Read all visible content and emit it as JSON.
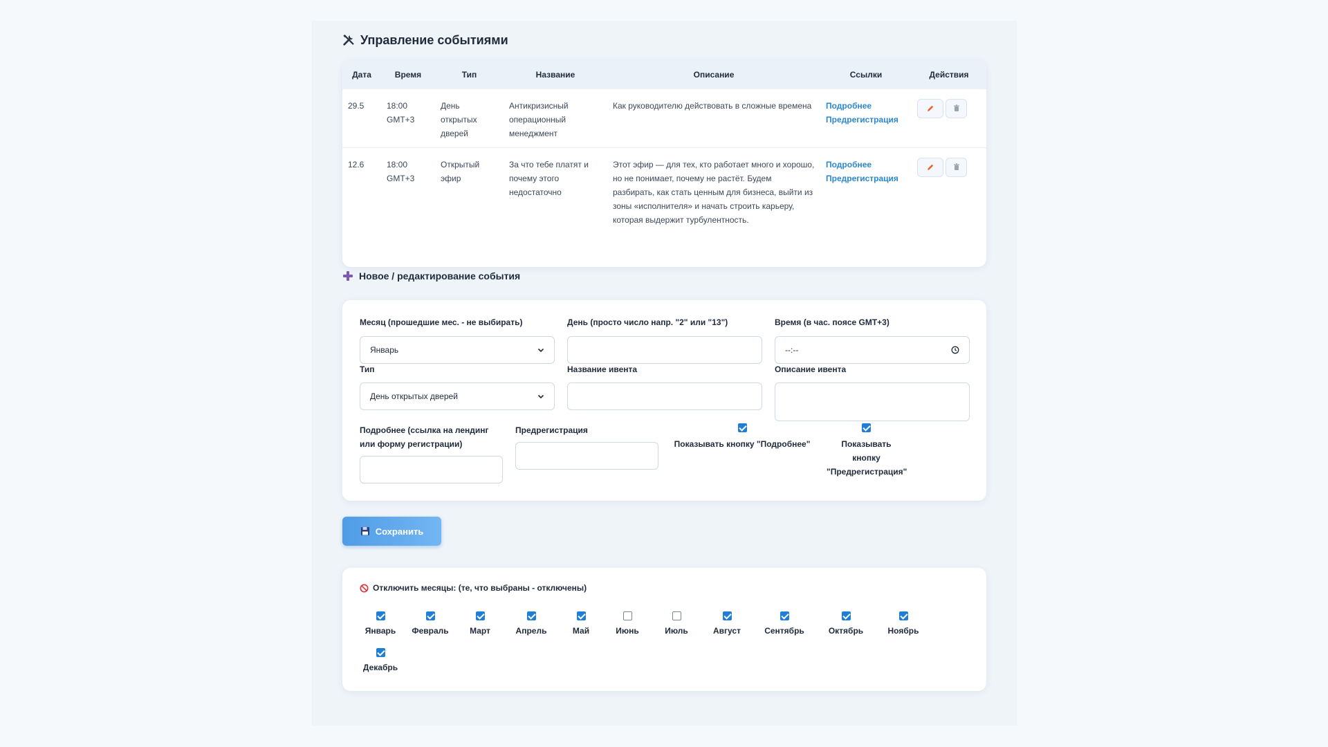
{
  "events": {
    "title": "Управление событиями",
    "columns": [
      "Дата",
      "Время",
      "Тип",
      "Название",
      "Описание",
      "Ссылки",
      "Действия"
    ],
    "rows": [
      {
        "date": "29.5",
        "time": "18:00 GMT+3",
        "type": "День открытых дверей",
        "name": "Антикризисный операционный менеджмент",
        "description": "Как руководителю действовать в сложные времена",
        "link_more": "Подробнее",
        "link_prereg": "Предрегистрация"
      },
      {
        "date": "12.6",
        "time": "18:00 GMT+3",
        "type": "Открытый эфир",
        "name": "За что тебе платят и почему этого недостаточно",
        "description": "Этот эфир — для тех, кто работает много и хорошо, но не понимает, почему не растёт. Будем разбирать, как стать ценным для бизнеса, выйти из зоны «исполнителя» и начать строить карьеру, которая выдержит турбулентность.",
        "link_more": "Подробнее",
        "link_prereg": "Предрегистрация"
      }
    ]
  },
  "form": {
    "title": "Новое / редактирование события",
    "month_label": "Месяц (прошедшие мес. - не выбирать)",
    "month_value": "Январь",
    "day_label": "День (просто число напр. \"2\" или \"13\")",
    "day_value": "",
    "time_label": "Время (в час. поясе GMT+3)",
    "time_value": "--:--",
    "type_label": "Тип",
    "type_value": "День открытых дверей",
    "name_label": "Название ивента",
    "name_value": "",
    "desc_label": "Описание ивента",
    "more_label": "Подробнее (ссылка на лендинг или форму регистрации)",
    "prereg_label": "Предрегистрация",
    "show_more_label": "Показывать кнопку \"Подробнее\"",
    "show_more_checked": true,
    "show_prereg_label": "Показывать кнопку \"Предрегистрация\"",
    "show_prereg_checked": true
  },
  "save_label": "Сохранить",
  "disable_months": {
    "title": "Отключить месяцы: (те, что выбраны - отключены)",
    "months": [
      {
        "name": "Январь",
        "checked": true
      },
      {
        "name": "Февраль",
        "checked": true
      },
      {
        "name": "Март",
        "checked": true
      },
      {
        "name": "Апрель",
        "checked": true
      },
      {
        "name": "Май",
        "checked": true
      },
      {
        "name": "Июнь",
        "checked": false
      },
      {
        "name": "Июль",
        "checked": false
      },
      {
        "name": "Август",
        "checked": true
      },
      {
        "name": "Сентябрь",
        "checked": true
      },
      {
        "name": "Октябрь",
        "checked": true
      },
      {
        "name": "Ноябрь",
        "checked": true
      },
      {
        "name": "Декабрь",
        "checked": true
      }
    ]
  },
  "colors": {
    "accent": "#2b87d1",
    "checkbox": "#1f7fd6",
    "edit_icon": "#e8622c",
    "disable_icon": "#e0333b",
    "plus_icon": "#7b5bb5"
  }
}
